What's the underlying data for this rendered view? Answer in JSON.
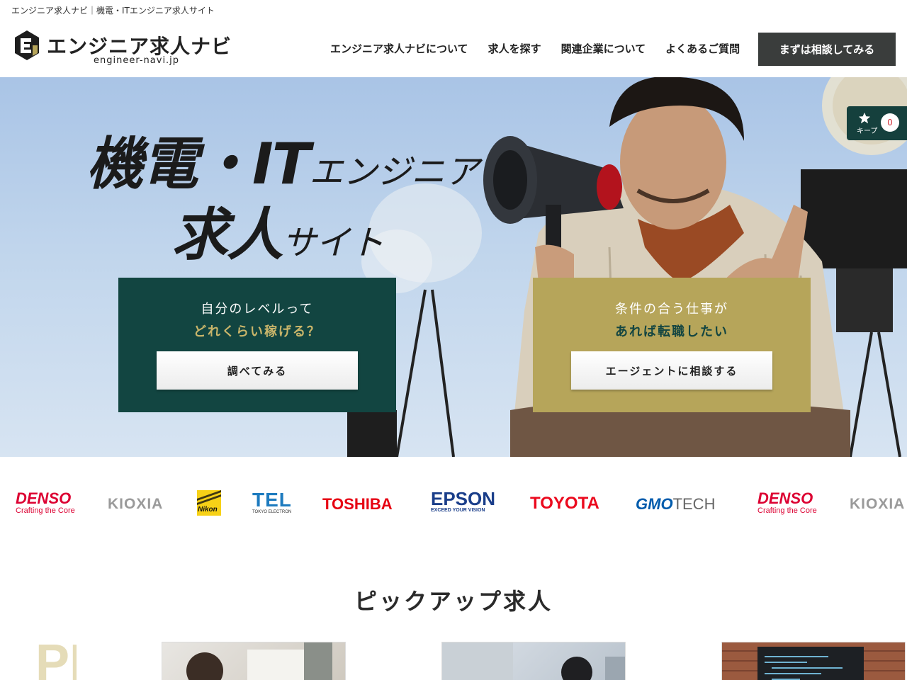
{
  "tagline": "エンジニア求人ナビ｜機電・ITエンジニア求人サイト",
  "header": {
    "logo_text": "エンジニア求人ナビ",
    "logo_domain": "engineer-navi.jp",
    "nav": [
      {
        "label": "エンジニア求人ナビについて"
      },
      {
        "label": "求人を探す"
      },
      {
        "label": "関連企業について"
      },
      {
        "label": "よくあるご質問"
      }
    ],
    "cta_label": "まずは相談してみる"
  },
  "hero": {
    "title_line1_big": "機電・IT",
    "title_line1_small": "エンジニア",
    "title_line2_big": "求人",
    "title_line2_small": "サイト",
    "card_left": {
      "line1": "自分のレベルって",
      "line2": "どれくらい稼げる？",
      "button": "調べてみる"
    },
    "card_right": {
      "line1": "条件の合う仕事が",
      "line2": "あれば転職したい",
      "button": "エージェントに相談する"
    },
    "keep": {
      "label": "キープ",
      "count": "0"
    }
  },
  "logos": {
    "denso": "DENSO",
    "denso_tagline": "Crafting the Core",
    "kioxia": "KIOXIA",
    "nikon": "Nikon",
    "tel": "TEL",
    "tel_sub": "TOKYO ELECTRON",
    "toshiba": "TOSHIBA",
    "epson": "EPSON",
    "epson_sub": "EXCEED YOUR VISION",
    "toyota": "TOYOTA",
    "gmo": "GMO",
    "gmo_tech": "TECH"
  },
  "pickup": {
    "title": "ピックアップ求人",
    "deco": "PI"
  },
  "colors": {
    "dark_green": "#124541",
    "gold": "#b6a55a",
    "cta_dark": "#3a3d3c",
    "denso_red": "#dc0032",
    "toyota_red": "#eb0a1e",
    "epson_blue": "#1a3e8a",
    "tel_blue": "#1e7bbf"
  }
}
